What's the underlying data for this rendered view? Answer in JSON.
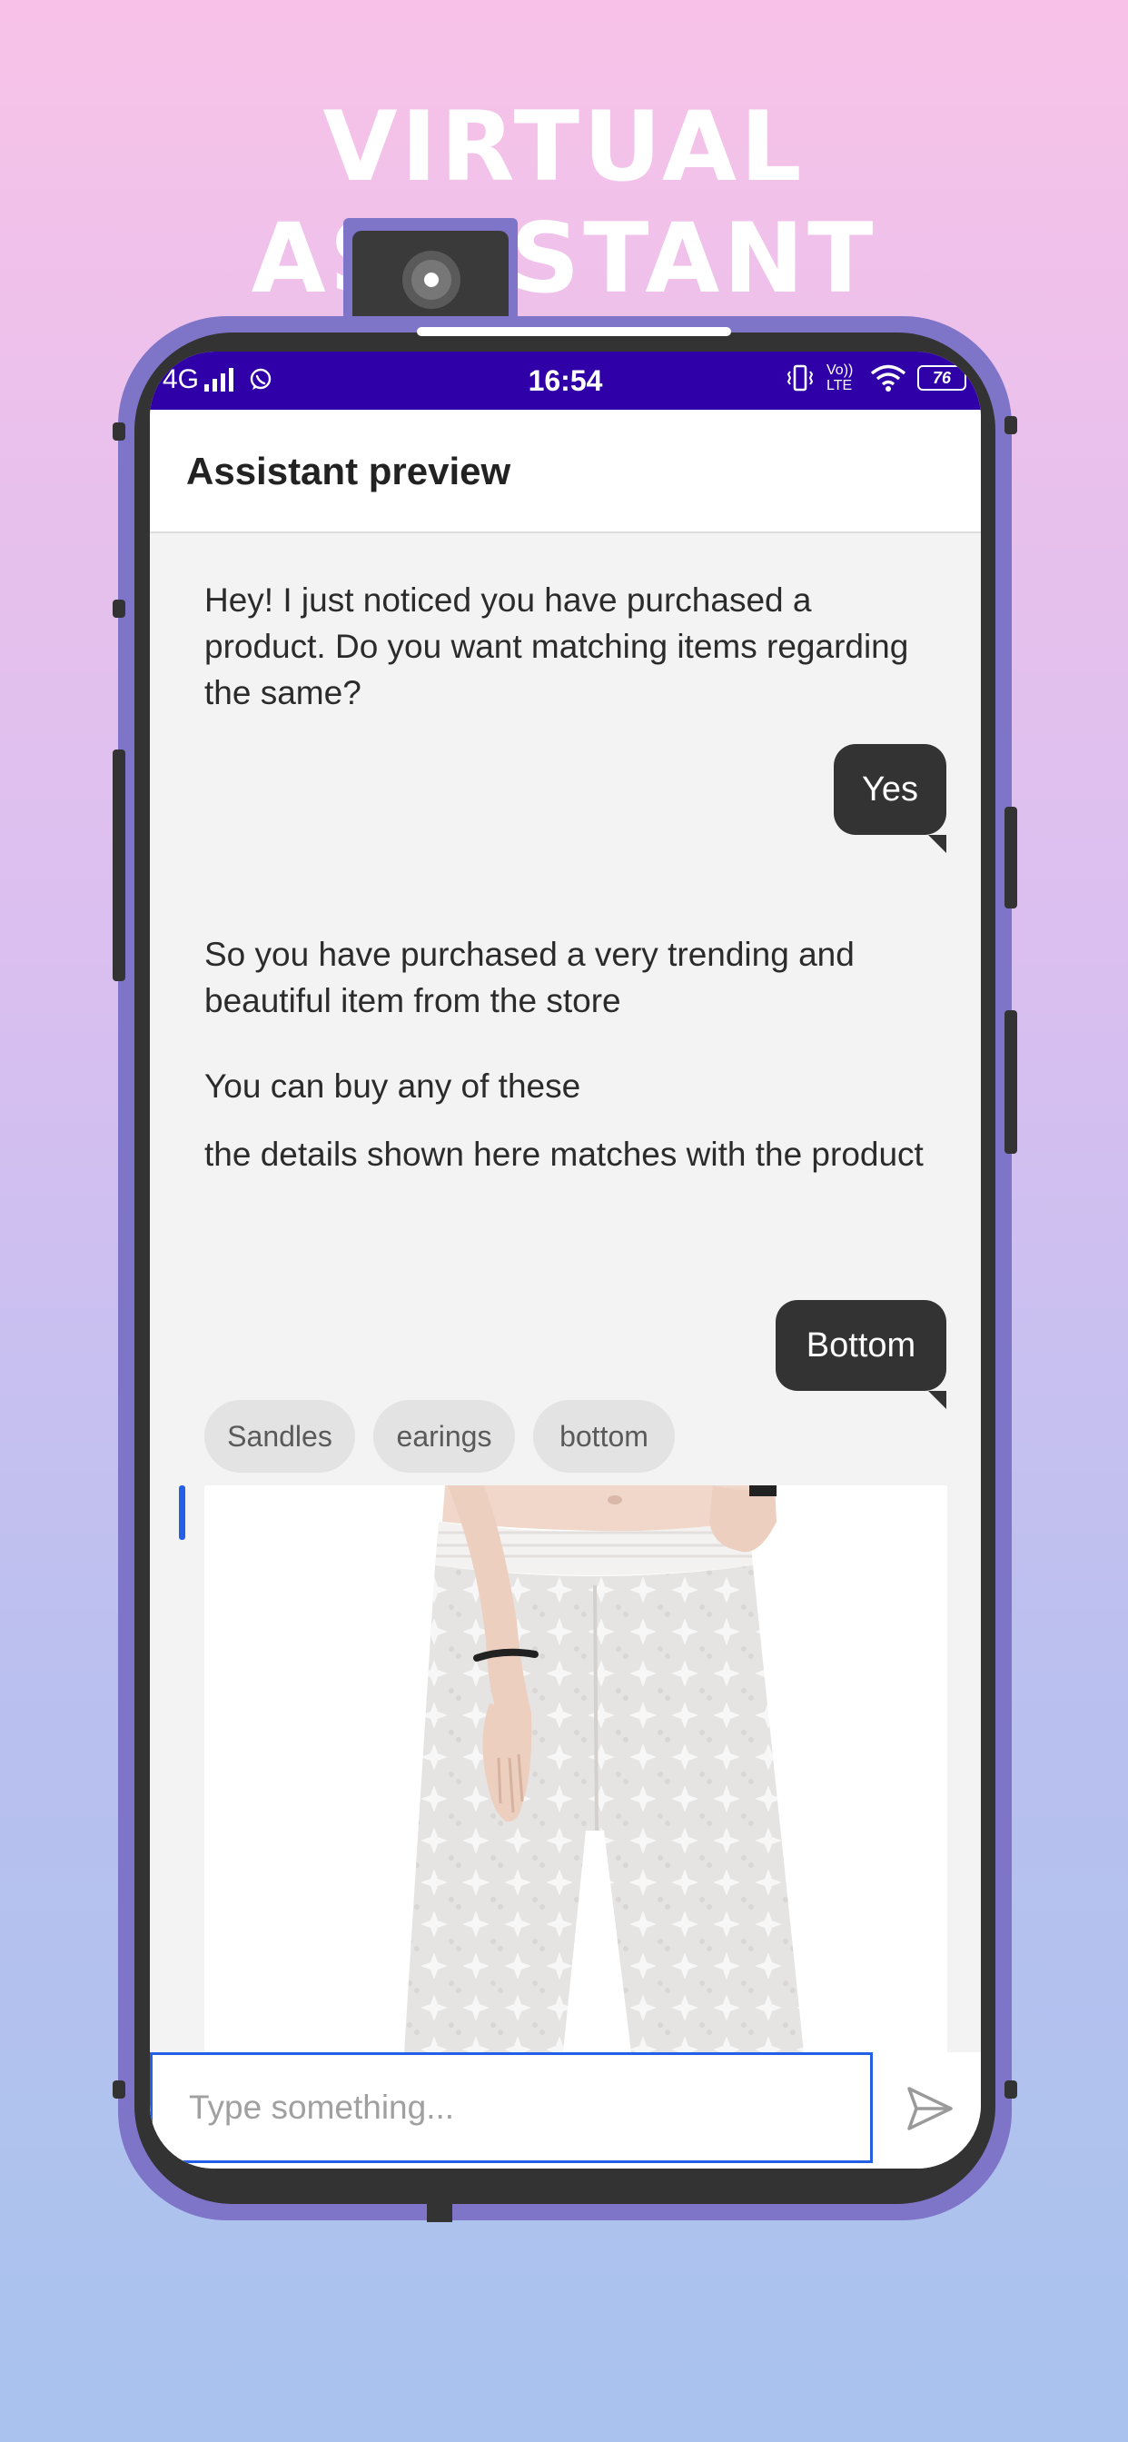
{
  "banner": {
    "title": "VIRTUAL ASSISTANT"
  },
  "status_bar": {
    "network": "4G",
    "time": "16:54",
    "volte": "Vo)) LTE",
    "battery": "76"
  },
  "app_bar": {
    "title": "Assistant preview"
  },
  "chat": {
    "messages": [
      {
        "from": "bot",
        "text": "Hey! I just noticed you have purchased a product. Do you want matching items regarding the same?"
      },
      {
        "from": "user",
        "text": "Yes"
      },
      {
        "from": "bot",
        "text": "So you have purchased a very trending and beautiful item from the store"
      },
      {
        "from": "bot",
        "text": "You can buy any of these"
      },
      {
        "from": "bot",
        "text": "the details shown here matches with the product"
      },
      {
        "from": "user",
        "text": "Bottom"
      }
    ],
    "quick_replies": [
      "Sandles",
      "earings",
      "bottom"
    ]
  },
  "composer": {
    "placeholder": "Type something..."
  },
  "colors": {
    "status_bar": "#2f00a8",
    "phone_frame": "#7e75c9",
    "accent": "#2460e6",
    "user_bubble": "#333333"
  },
  "icons": {
    "send": "send-icon",
    "signal": "signal-icon",
    "wifi": "wifi-icon",
    "whatsapp": "whatsapp-icon",
    "vibrate": "vibrate-icon"
  }
}
